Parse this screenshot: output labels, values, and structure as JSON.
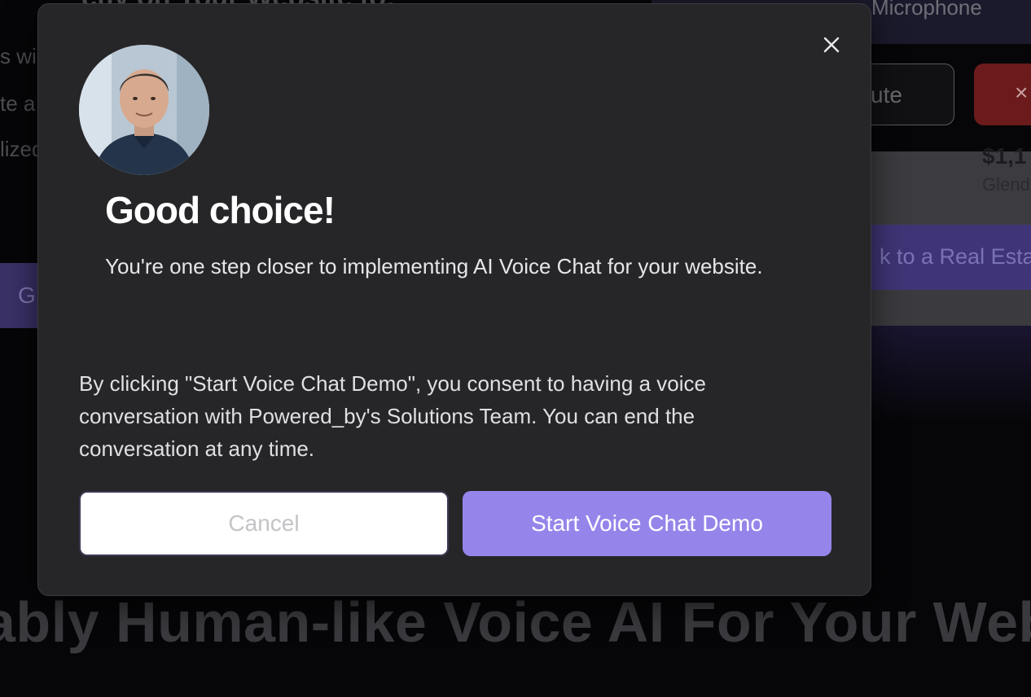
{
  "background": {
    "top_heading": "ctly on Your Website to:",
    "line_1": "s wi",
    "line_2": "te a",
    "line_3": "lized",
    "microphone_label": "Microphone",
    "outline_button_label": "ute",
    "red_button_label": "×",
    "price": "$1,1",
    "city": "Glend",
    "purple_strip_label": "k to a Real Estat",
    "left_purple_label": "G",
    "big_heading": "ably Human-like Voice AI For Your Web"
  },
  "modal": {
    "close_icon": "close-icon",
    "avatar_alt": "avatar",
    "title": "Good choice!",
    "subtitle": "You're one step closer to implementing AI Voice Chat for your website.",
    "consent": "By clicking \"Start Voice Chat Demo\", you consent to having a voice conversation with Powered_by's Solutions Team. You can end the conversation at any time.",
    "cancel_label": "Cancel",
    "start_label": "Start Voice Chat Demo"
  },
  "colors": {
    "accent": "#9585ea",
    "modal_bg": "#262628",
    "page_bg": "#060608"
  }
}
